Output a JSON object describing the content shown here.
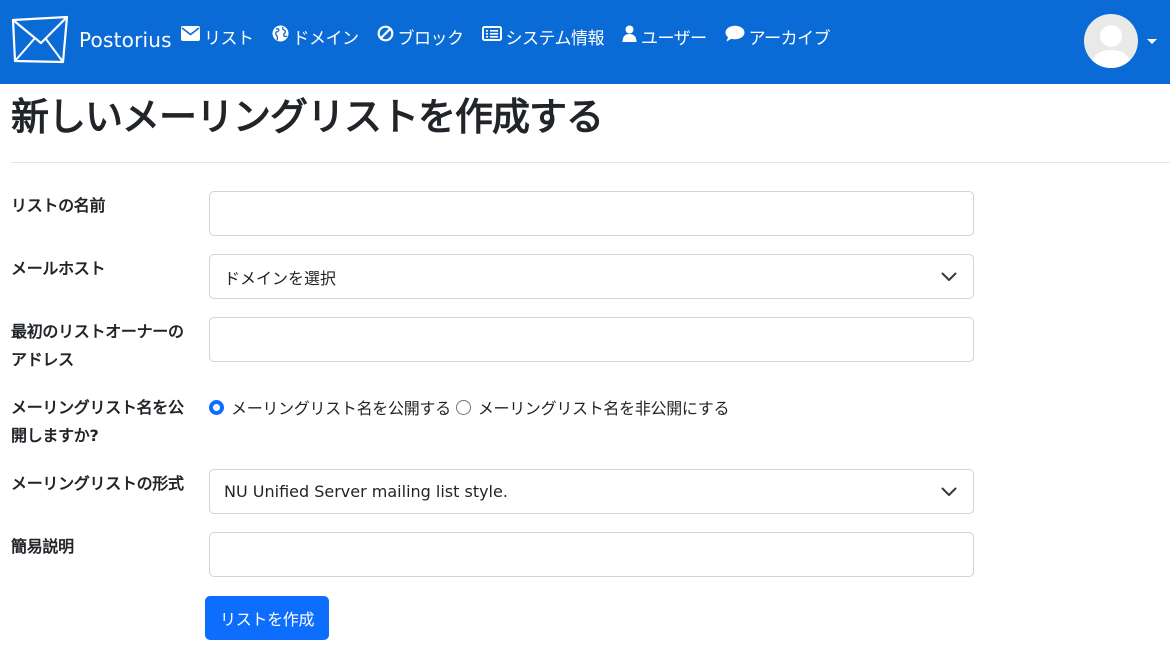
{
  "navbar": {
    "brand": "Postorius",
    "items": [
      {
        "icon": "envelope-icon",
        "label": "リスト"
      },
      {
        "icon": "globe-icon",
        "label": "ドメイン"
      },
      {
        "icon": "ban-icon",
        "label": "ブロック"
      },
      {
        "icon": "list-alt-icon",
        "label": "システム情報"
      },
      {
        "icon": "user-icon",
        "label": "ユーザー"
      },
      {
        "icon": "comment-icon",
        "label": "アーカイブ"
      }
    ],
    "bg_color": "#0b6bd6"
  },
  "page": {
    "title": "新しいメーリングリストを作成する"
  },
  "form": {
    "list_name": {
      "label": "リストの名前",
      "value": ""
    },
    "mail_host": {
      "label": "メールホスト",
      "selected": "ドメインを選択"
    },
    "owner_address": {
      "label_line1": "最初のリストオーナーの",
      "label_line2": "アドレス",
      "value": ""
    },
    "advertised": {
      "label_line1": "メーリングリスト名を公",
      "label_line2": "開しますか?",
      "options": [
        {
          "label": "メーリングリスト名を公開する",
          "checked": true
        },
        {
          "label": "メーリングリスト名を非公開にする",
          "checked": false
        }
      ]
    },
    "list_style": {
      "label": "メーリングリストの形式",
      "selected": "NU Unified Server mailing list style."
    },
    "description": {
      "label": "簡易説明",
      "value": ""
    },
    "submit_label": "リストを作成",
    "accent_color": "#0d6efd"
  }
}
